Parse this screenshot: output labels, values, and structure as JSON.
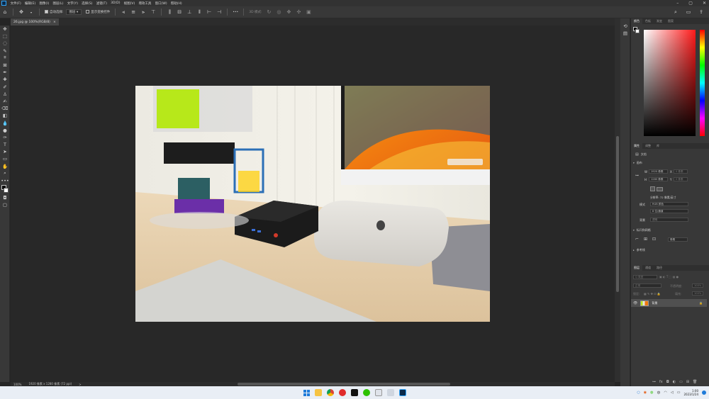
{
  "menu": [
    "文件(F)",
    "编辑(E)",
    "图像(I)",
    "图层(L)",
    "文字(Y)",
    "选择(S)",
    "滤镜(T)",
    "3D(D)",
    "视图(V)",
    "增效工具",
    "窗口(W)",
    "帮助(H)"
  ],
  "window_controls": [
    "–",
    "▢",
    "✕"
  ],
  "options": {
    "auto_select_label": "自动选择:",
    "auto_select_value": "图层",
    "show_transform_label": "显示变换控件",
    "mode_3d_label": "3D 模式:",
    "more": "•••"
  },
  "doc_tab": {
    "title": "26.jpg @ 100%(RGB/8)",
    "close": "×"
  },
  "status": {
    "zoom": "100%",
    "info": "1920 像素 x 1280 像素 (72 ppi)",
    "arrow": ">"
  },
  "right_panel": {
    "color_tabs": [
      "颜色",
      "色板",
      "渐变",
      "图案"
    ],
    "props_tabs": [
      "属性",
      "调整",
      "库"
    ],
    "doc_label": "文档",
    "canvas_title": "画布",
    "w_label": "W",
    "w_value": "1920 像素",
    "x_label": "X",
    "x_value": "0 像素",
    "h_label": "H",
    "h_value": "1280 像素",
    "y_label": "Y",
    "y_value": "0 像素",
    "resolution": "分辨率: 72 像素/英寸",
    "mode_label": "模式",
    "mode_value": "RGB 颜色",
    "depth_value": "8 位/通道",
    "bg_label": "背景",
    "bg_value": "透明",
    "rulers_title": "标尺和网格",
    "unit_value": "像素",
    "guides_title": "参考线",
    "layers_tabs": [
      "图层",
      "通道",
      "路径"
    ],
    "kind_label": "Q 类型",
    "blend_value": "正常",
    "opacity_label": "不透明度:",
    "opacity_value": "100%",
    "lock_label": "锁定:",
    "fill_label": "填充:",
    "fill_value": "100%",
    "layer_name": "背景"
  },
  "taskbar": {
    "time": "1:00",
    "date": "2023/1/24"
  },
  "colors": {
    "ps_blue": "#31a8ff",
    "picker_hue": "#ff1a1a"
  }
}
